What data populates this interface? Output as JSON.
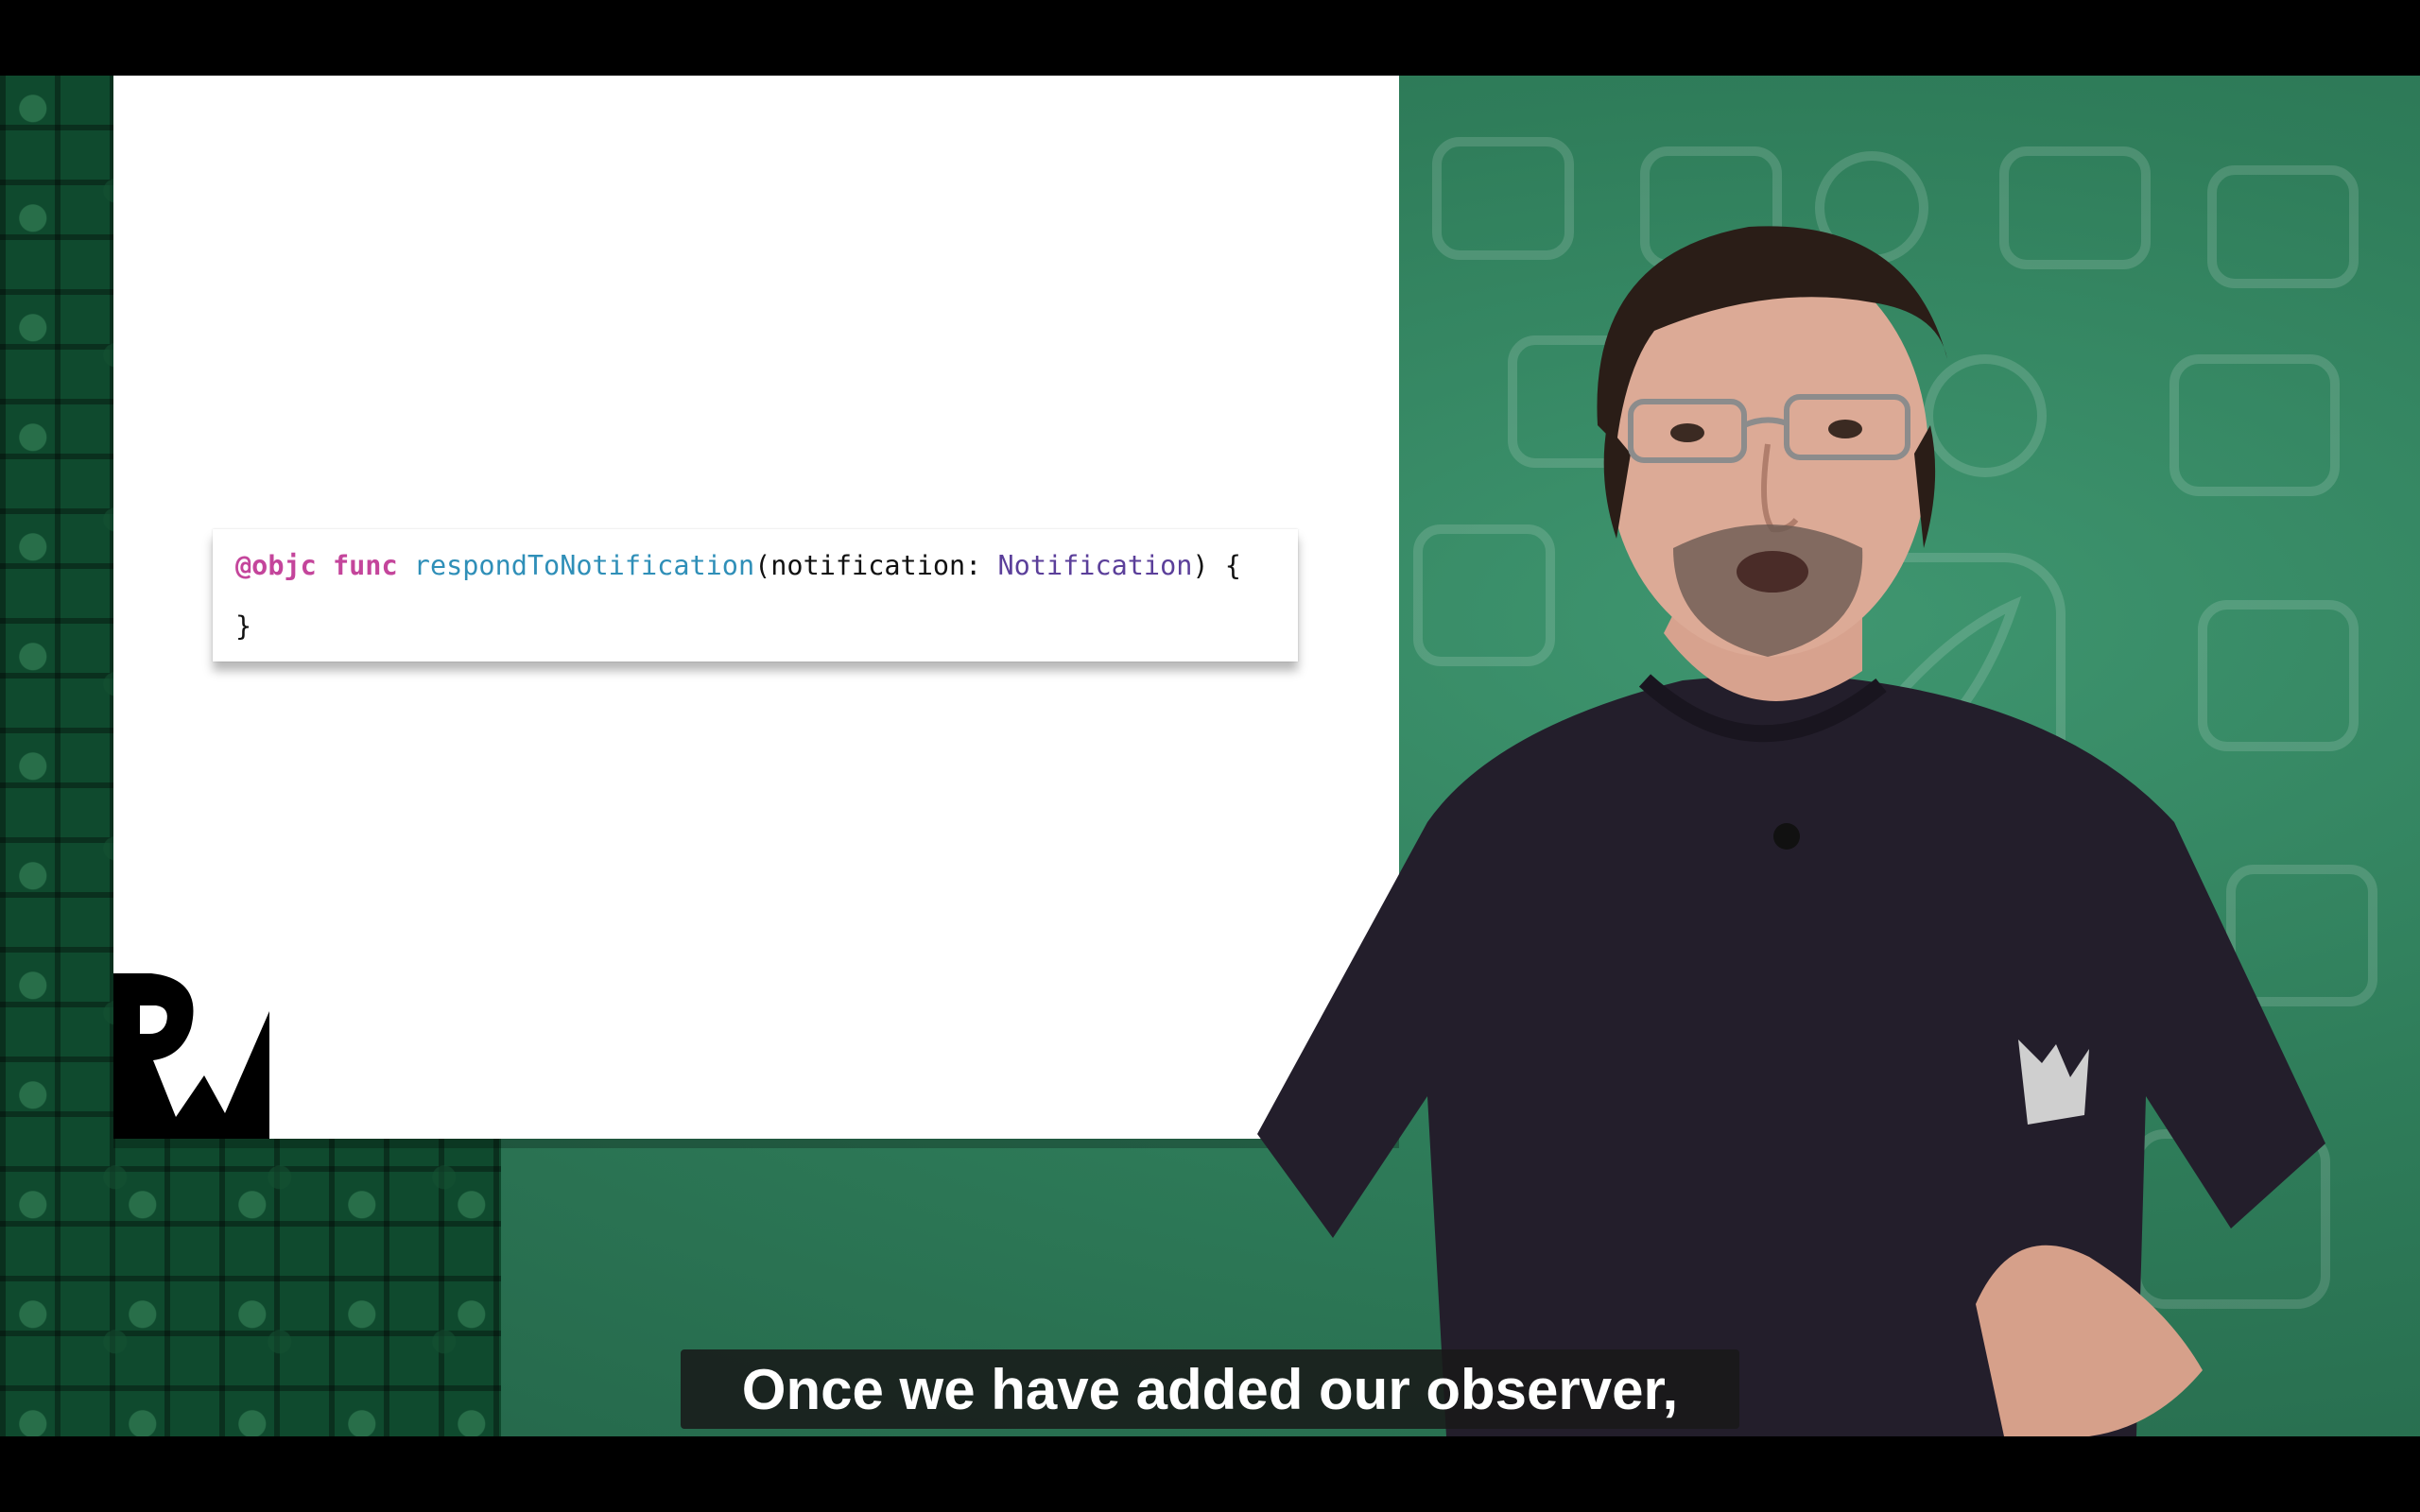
{
  "code": {
    "line1": [
      {
        "text": "@objc",
        "kind": "attr"
      },
      {
        "text": " ",
        "kind": "plain"
      },
      {
        "text": "func",
        "kind": "kw"
      },
      {
        "text": " ",
        "kind": "plain"
      },
      {
        "text": "respondToNotification",
        "kind": "fn"
      },
      {
        "text": "(notification: ",
        "kind": "plain"
      },
      {
        "text": "Notification",
        "kind": "type"
      },
      {
        "text": ") {",
        "kind": "plain"
      }
    ],
    "line2": [
      {
        "text": "}",
        "kind": "plain"
      }
    ]
  },
  "caption": {
    "text": "Once we have added our observer,"
  },
  "icons": {
    "logo": "rw-logo-icon",
    "presenter": "presenter-image",
    "background": "app-icons-pattern"
  },
  "colors": {
    "background_green": "#2f7d5a",
    "dark_green_tiles": "#0f4a2e",
    "code_keyword": "#c4459b",
    "code_function": "#2f8fb8",
    "code_type": "#5b3f9a",
    "caption_bg": "#191919"
  }
}
